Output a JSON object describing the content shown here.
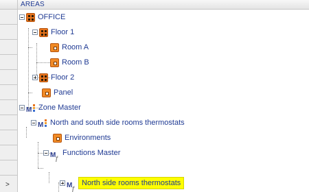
{
  "header": {
    "title": "AREAS"
  },
  "gutter": {
    "arrow": ">"
  },
  "tree": {
    "nodes": [
      {
        "label": "OFFICE",
        "icon": "area-grid-icon",
        "expander": "minus"
      },
      {
        "label": "Floor 1",
        "icon": "area-grid-icon",
        "expander": "minus"
      },
      {
        "label": "Room A",
        "icon": "room-box-icon"
      },
      {
        "label": "Room B",
        "icon": "room-box-icon"
      },
      {
        "label": "Floor 2",
        "icon": "area-grid-icon",
        "expander": "plus"
      },
      {
        "label": "Panel",
        "icon": "room-box-icon"
      },
      {
        "label": "Zone Master",
        "icon": "zone-master-icon",
        "expander": "minus"
      },
      {
        "label": "North and south side rooms thermostats",
        "icon": "zone-master-icon",
        "expander": "minus"
      },
      {
        "label": "Environments",
        "icon": "room-box-icon"
      },
      {
        "label": "Functions Master",
        "icon": "functions-master-icon",
        "expander": "minus"
      },
      {
        "label": "North side rooms thermostats",
        "icon": "functions-master-icon",
        "expander": "plus",
        "selected": true
      }
    ]
  },
  "colors": {
    "accent_orange": "#f08a26",
    "selection": "#ffff00",
    "text": "#1f3a93"
  }
}
